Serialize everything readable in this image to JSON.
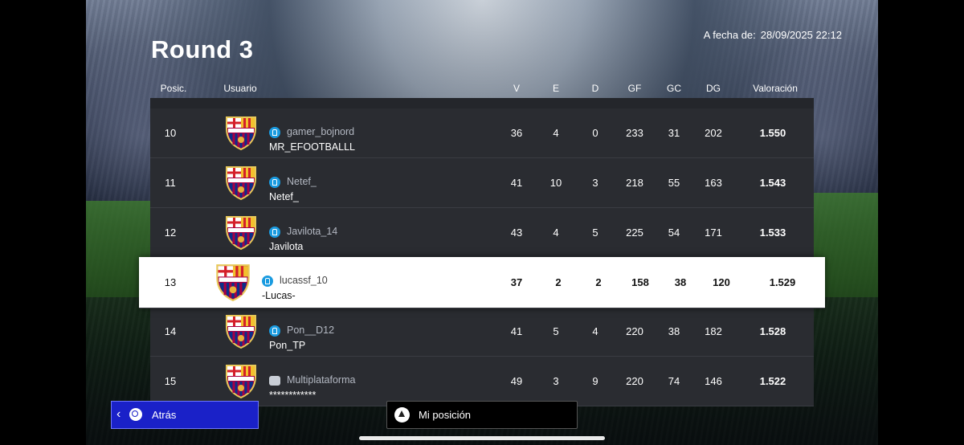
{
  "title": "Round 3",
  "date": {
    "label": "A fecha de:",
    "value": "28/09/2025 22:12"
  },
  "headers": {
    "pos": "Posic.",
    "user": "Usuario",
    "v": "V",
    "e": "E",
    "d": "D",
    "gf": "GF",
    "gc": "GC",
    "dg": "DG",
    "val": "Valoración"
  },
  "rows": [
    {
      "pos": "10",
      "platform": "playstation",
      "id": "gamer_bojnord",
      "nick": "MR_EFOOTBALLL",
      "v": "36",
      "e": "4",
      "d": "0",
      "gf": "233",
      "gc": "31",
      "dg": "202",
      "val": "1.550"
    },
    {
      "pos": "11",
      "platform": "playstation",
      "id": "Netef_",
      "nick": "Netef_",
      "v": "41",
      "e": "10",
      "d": "3",
      "gf": "218",
      "gc": "55",
      "dg": "163",
      "val": "1.543"
    },
    {
      "pos": "12",
      "platform": "playstation",
      "id": "Javilota_14",
      "nick": "Javilota",
      "v": "43",
      "e": "4",
      "d": "5",
      "gf": "225",
      "gc": "54",
      "dg": "171",
      "val": "1.533"
    },
    {
      "pos": "13",
      "platform": "playstation",
      "id": "lucassf_10",
      "nick": "-Lucas-",
      "v": "37",
      "e": "2",
      "d": "2",
      "gf": "158",
      "gc": "38",
      "dg": "120",
      "val": "1.529",
      "highlighted": true
    },
    {
      "pos": "14",
      "platform": "playstation",
      "id": "Pon__D12",
      "nick": "Pon_TP",
      "v": "41",
      "e": "5",
      "d": "4",
      "gf": "220",
      "gc": "38",
      "dg": "182",
      "val": "1.528"
    },
    {
      "pos": "15",
      "platform": "crossplatform",
      "id": "Multiplataforma",
      "nick": "************",
      "v": "49",
      "e": "3",
      "d": "9",
      "gf": "220",
      "gc": "74",
      "dg": "146",
      "val": "1.522"
    }
  ],
  "buttons": {
    "back": "Atrás",
    "my_position": "Mi posición"
  },
  "colors": {
    "back_button": "#1a21c8",
    "ps_icon": "#1a9be0",
    "highlight_row": "#ffffff"
  }
}
